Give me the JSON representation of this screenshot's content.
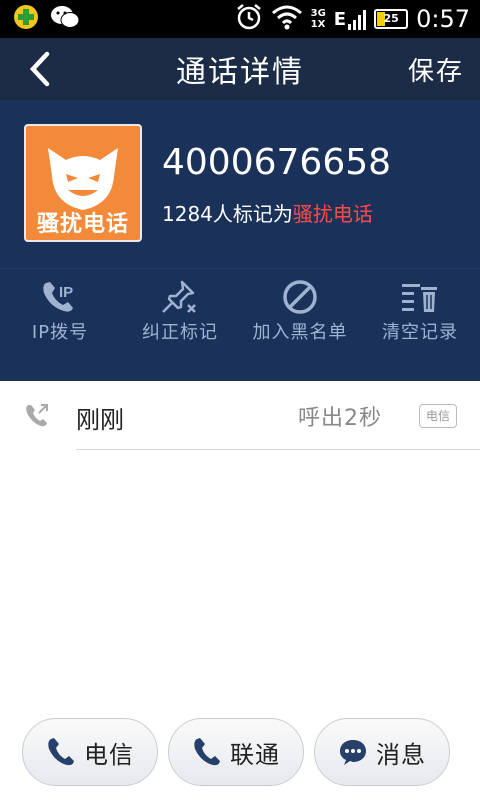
{
  "status_bar": {
    "time": "0:57",
    "network_top": "3G",
    "network_bottom": "1X",
    "edge_letter": "E",
    "battery": "25"
  },
  "app_bar": {
    "title": "通话详情",
    "save_label": "保存"
  },
  "contact": {
    "avatar_tag": "骚扰电话",
    "number": "4000676658",
    "mark_count": "1284",
    "mark_text": "人标记为",
    "mark_label": "骚扰电话"
  },
  "actions": [
    {
      "label": "IP拨号",
      "icon": "ip-dial-icon"
    },
    {
      "label": "纠正标记",
      "icon": "correct-mark-icon"
    },
    {
      "label": "加入黑名单",
      "icon": "block-icon"
    },
    {
      "label": "清空记录",
      "icon": "clear-records-icon"
    }
  ],
  "call_log": [
    {
      "time": "刚刚",
      "description": "呼出2秒",
      "carrier": "电信",
      "icon": "outgoing-call-icon"
    }
  ],
  "bottom_buttons": [
    {
      "label": "电信",
      "icon": "phone-icon"
    },
    {
      "label": "联通",
      "icon": "phone-icon"
    },
    {
      "label": "消息",
      "icon": "message-icon"
    }
  ],
  "colors": {
    "app_bar": "#1c2c47",
    "header": "#1a315a",
    "avatar_bg": "#f28a3a",
    "spam_red": "#ff4a4a"
  }
}
